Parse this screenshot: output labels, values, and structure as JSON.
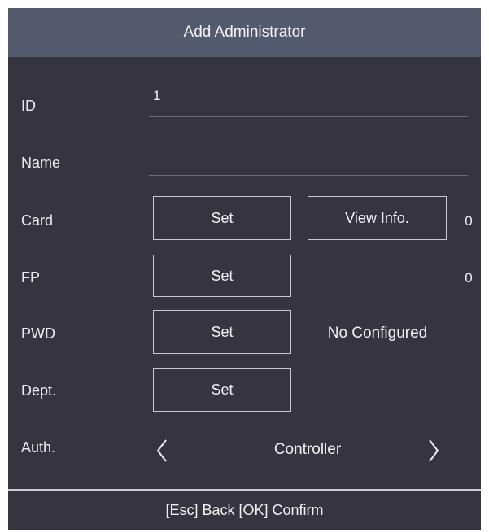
{
  "title": "Add Administrator",
  "fields": {
    "id": {
      "label": "ID",
      "value": "1"
    },
    "name": {
      "label": "Name",
      "value": ""
    },
    "card": {
      "label": "Card",
      "set_label": "Set",
      "view_label": "View Info.",
      "count": "0"
    },
    "fp": {
      "label": "FP",
      "set_label": "Set",
      "count": "0"
    },
    "pwd": {
      "label": "PWD",
      "set_label": "Set",
      "status": "No Configured"
    },
    "dept": {
      "label": "Dept.",
      "set_label": "Set"
    },
    "auth": {
      "label": "Auth.",
      "value": "Controller",
      "prev_icon": "chevron-left-icon",
      "next_icon": "chevron-right-icon"
    }
  },
  "footer": {
    "hint": "[Esc] Back [OK] Confirm"
  },
  "colors": {
    "background": "#36353f",
    "title_bar": "#535a6e",
    "text": "#f2f2f2",
    "button_border": "#c9c9c9"
  }
}
